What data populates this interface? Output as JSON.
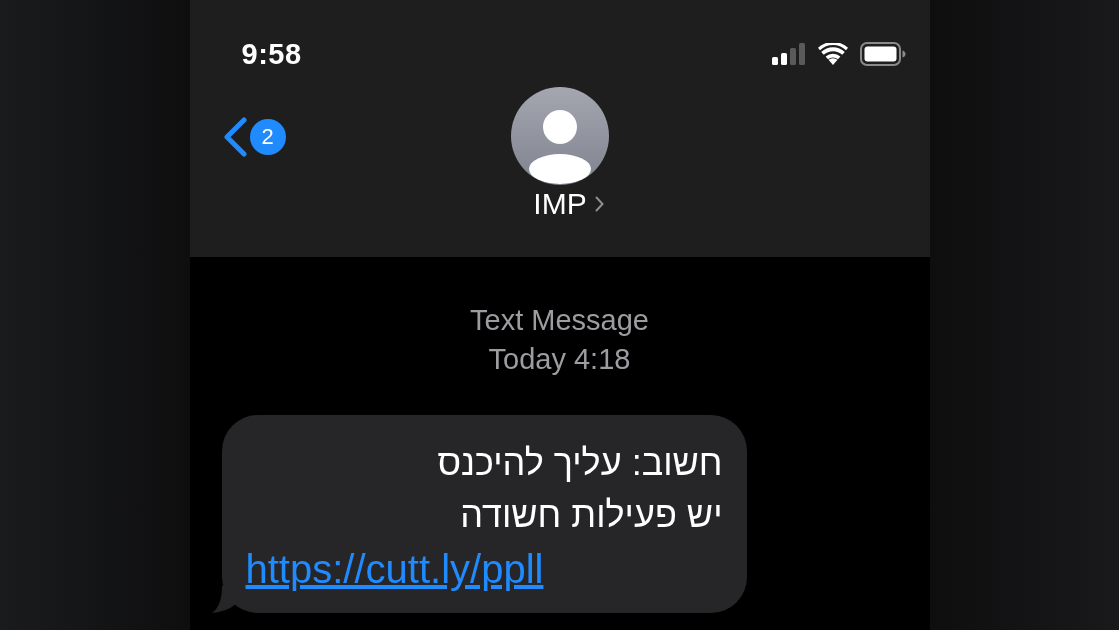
{
  "status_bar": {
    "time": "9:58"
  },
  "header": {
    "back_badge": "2",
    "contact_name": "IMP"
  },
  "thread": {
    "service": "Text Message",
    "timestamp": "Today 4:18"
  },
  "message": {
    "lines": [
      "חשוב: עליך להיכנס",
      "יש פעילות חשודה"
    ],
    "link": "https://cutt.ly/ppll"
  }
}
